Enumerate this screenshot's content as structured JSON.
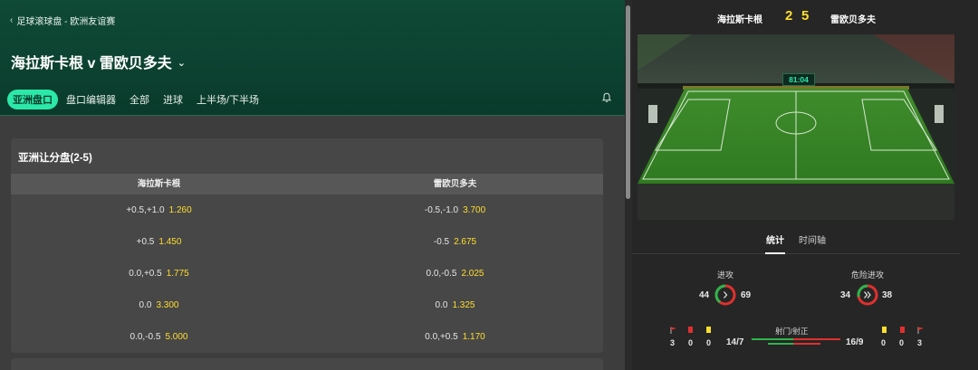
{
  "breadcrumb": "足球滚球盘 - 欧洲友谊赛",
  "match": {
    "title": "海拉斯卡根 v 雷欧贝多夫"
  },
  "tabs": [
    {
      "label": "亚洲盘口",
      "active": true
    },
    {
      "label": "盘口编辑器",
      "active": false
    },
    {
      "label": "全部",
      "active": false
    },
    {
      "label": "进球",
      "active": false
    },
    {
      "label": "上半场/下半场",
      "active": false
    }
  ],
  "market": {
    "title": "亚洲让分盘(2-5)",
    "home_header": "海拉斯卡根",
    "away_header": "雷欧贝多夫",
    "rows": [
      {
        "home_line": "+0.5,+1.0",
        "home_odds": "1.260",
        "away_line": "-0.5,-1.0",
        "away_odds": "3.700"
      },
      {
        "home_line": "+0.5",
        "home_odds": "1.450",
        "away_line": "-0.5",
        "away_odds": "2.675"
      },
      {
        "home_line": "0.0,+0.5",
        "home_odds": "1.775",
        "away_line": "0.0,-0.5",
        "away_odds": "2.025"
      },
      {
        "home_line": "0.0",
        "home_odds": "3.300",
        "away_line": "0.0",
        "away_odds": "1.325"
      },
      {
        "home_line": "0.0,-0.5",
        "home_odds": "5.000",
        "away_line": "0.0,+0.5",
        "away_odds": "1.170"
      }
    ]
  },
  "scoreboard": {
    "home_team": "海拉斯卡根",
    "away_team": "雷欧贝多夫",
    "home_score": "2",
    "away_score": "5",
    "clock": "81:04"
  },
  "stats_tabs": {
    "stats": "统计",
    "timeline": "时间轴"
  },
  "stats": {
    "attacks": {
      "label": "进攻",
      "home": "44",
      "away": "69"
    },
    "dangerous_attacks": {
      "label": "危险进攻",
      "home": "34",
      "away": "38"
    },
    "shots": {
      "label": "射门/射正",
      "home": "14/7",
      "away": "16/9"
    },
    "home_corners": "3",
    "home_red": "0",
    "home_yellow": "0",
    "away_yellow": "0",
    "away_red": "0",
    "away_corners": "3"
  },
  "colors": {
    "accent": "#2be8a9",
    "odds": "#ffde2e",
    "home": "#2db54b",
    "away": "#e0302e"
  },
  "icons": {
    "bell": "bell-icon",
    "back": "chevron-left-icon",
    "dropdown": "chevron-down-icon",
    "corner": "corner-flag-icon"
  }
}
